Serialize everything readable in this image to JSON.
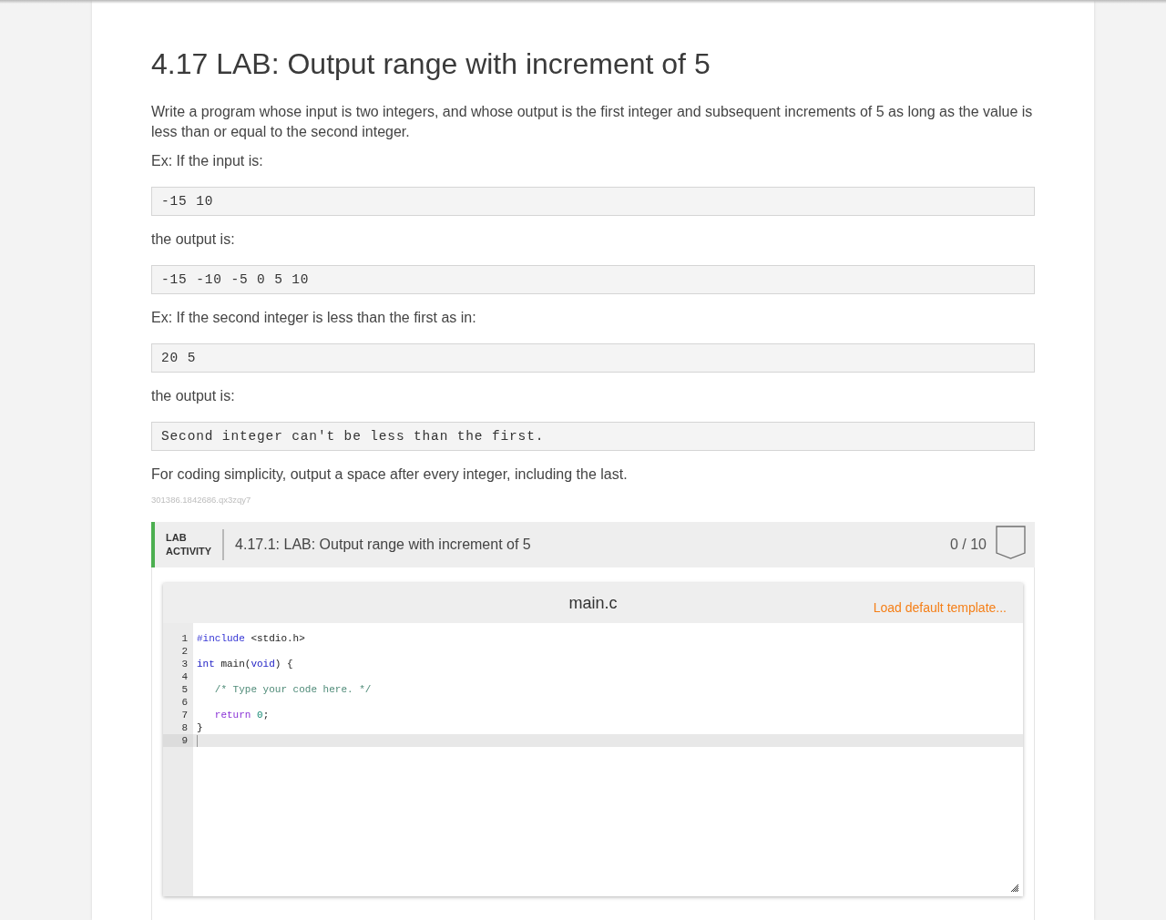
{
  "page": {
    "title": "4.17 LAB: Output range with increment of 5"
  },
  "content": [
    {
      "kind": "paragraph",
      "text": "Write a program whose input is two integers, and whose output is the first integer and subsequent increments of 5 as long as the value is less than or equal to the second integer."
    },
    {
      "kind": "paragraph",
      "text": "Ex: If the input is:"
    },
    {
      "kind": "code",
      "text": "-15 10"
    },
    {
      "kind": "paragraph",
      "text": "the output is:"
    },
    {
      "kind": "code",
      "text": "-15 -10 -5 0 5 10"
    },
    {
      "kind": "paragraph",
      "text": "Ex: If the second integer is less than the first as in:"
    },
    {
      "kind": "code",
      "text": "20 5"
    },
    {
      "kind": "paragraph",
      "text": "the output is:"
    },
    {
      "kind": "code",
      "text": "Second integer can't be less than the first."
    },
    {
      "kind": "paragraph",
      "text": "For coding simplicity, output a space after every integer, including the last."
    }
  ],
  "section_id": "301386.1842686.qx3zqy7",
  "lab": {
    "label": "LAB ACTIVITY",
    "title": "4.17.1: LAB: Output range with increment of 5",
    "score": "0 / 10",
    "completed": false
  },
  "editor": {
    "filename": "main.c",
    "action": "Load default template...",
    "lines": [
      {
        "number": "1",
        "active": false,
        "tokens": [
          {
            "kind": "directive",
            "text": "#include"
          },
          {
            "kind": "plain",
            "text": " <stdio.h>"
          }
        ]
      },
      {
        "number": "2",
        "active": false
      },
      {
        "number": "3",
        "active": false,
        "tokens": [
          {
            "kind": "type",
            "text": "int"
          },
          {
            "kind": "plain",
            "text": " main("
          },
          {
            "kind": "type",
            "text": "void"
          },
          {
            "kind": "plain",
            "text": ") {"
          }
        ]
      },
      {
        "number": "4",
        "active": false
      },
      {
        "number": "5",
        "active": false,
        "tokens": [
          {
            "kind": "comment",
            "text": "   /* Type your code here. */"
          }
        ]
      },
      {
        "number": "6",
        "active": false
      },
      {
        "number": "7",
        "active": false,
        "tokens": [
          {
            "kind": "keyword",
            "text": "   return "
          },
          {
            "kind": "number",
            "text": "0"
          },
          {
            "kind": "plain",
            "text": ";"
          }
        ]
      },
      {
        "number": "8",
        "active": false,
        "tokens": [
          {
            "kind": "plain",
            "text": "}"
          }
        ]
      },
      {
        "number": "9",
        "active": true
      }
    ]
  }
}
